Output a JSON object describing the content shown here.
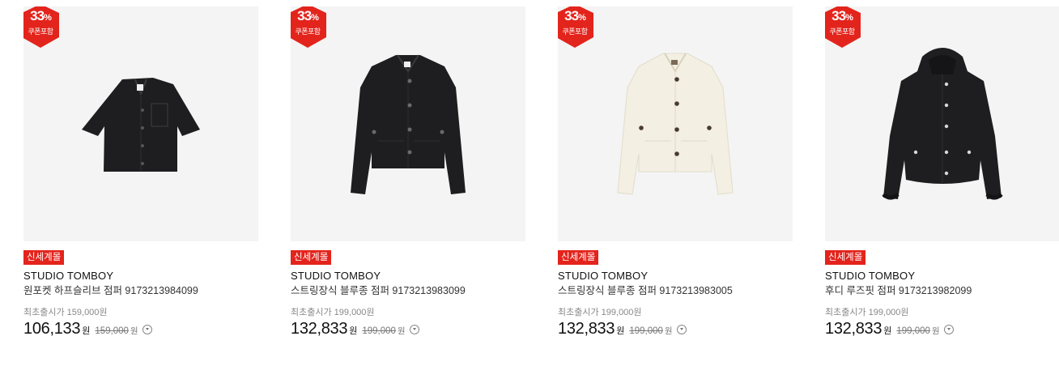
{
  "products": [
    {
      "discount_num": "33",
      "discount_sym": "%",
      "coupon_label": "쿠폰포함",
      "tag": "신세계몰",
      "brand": "STUDIO TOMBOY",
      "name": "원포켓 하프슬리브 점퍼 9173213984099",
      "original_label": "최초출시가 159,000원",
      "sale_price": "106,133",
      "currency": "원",
      "list_price": "159,000",
      "garment": "short-sleeve-black-jacket"
    },
    {
      "discount_num": "33",
      "discount_sym": "%",
      "coupon_label": "쿠폰포함",
      "tag": "신세계몰",
      "brand": "STUDIO TOMBOY",
      "name": "스트링장식 블루종 점퍼 9173213983099",
      "original_label": "최초출시가 199,000원",
      "sale_price": "132,833",
      "currency": "원",
      "list_price": "199,000",
      "garment": "black-blouson-jacket"
    },
    {
      "discount_num": "33",
      "discount_sym": "%",
      "coupon_label": "쿠폰포함",
      "tag": "신세계몰",
      "brand": "STUDIO TOMBOY",
      "name": "스트링장식 블루종 점퍼 9173213983005",
      "original_label": "최초출시가 199,000원",
      "sale_price": "132,833",
      "currency": "원",
      "list_price": "199,000",
      "garment": "ivory-blouson-jacket"
    },
    {
      "discount_num": "33",
      "discount_sym": "%",
      "coupon_label": "쿠폰포함",
      "tag": "신세계몰",
      "brand": "STUDIO TOMBOY",
      "name": "후디 루즈핏 점퍼 9173213982099",
      "original_label": "최초출시가 199,000원",
      "sale_price": "132,833",
      "currency": "원",
      "list_price": "199,000",
      "garment": "black-hooded-jacket"
    }
  ],
  "colors": {
    "badge": "#e3241c",
    "tag": "#e3241c",
    "thumb_bg": "#f4f4f4",
    "black_garment": "#1e1e20",
    "ivory_garment": "#f3efe2"
  }
}
